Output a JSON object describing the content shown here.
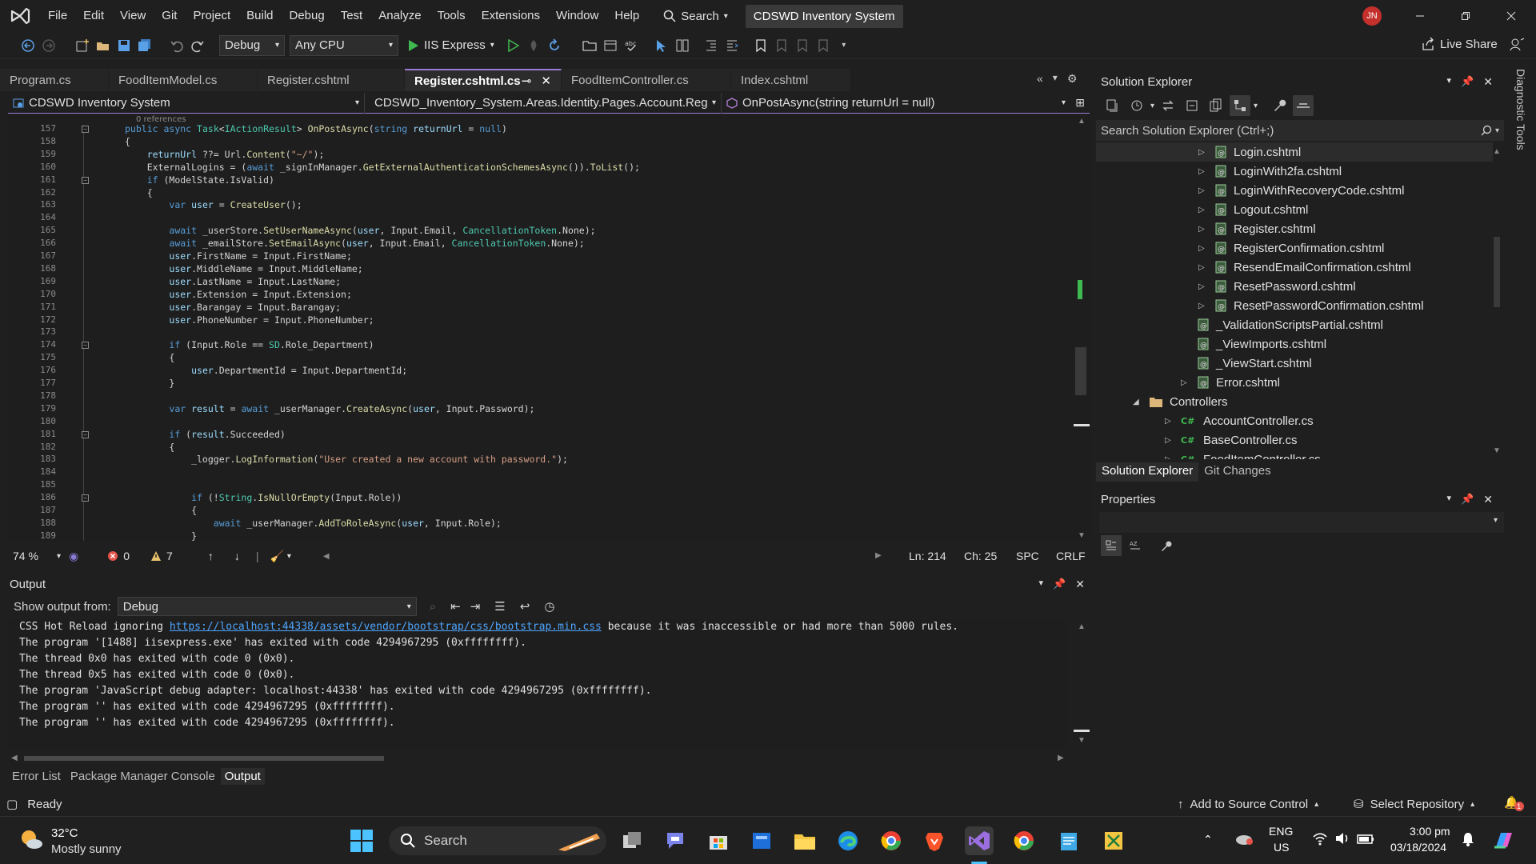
{
  "menu": {
    "items": [
      "File",
      "Edit",
      "View",
      "Git",
      "Project",
      "Build",
      "Debug",
      "Test",
      "Analyze",
      "Tools",
      "Extensions",
      "Window",
      "Help"
    ],
    "search_label": "Search",
    "solution_badge": "CDSWD Inventory System",
    "avatar_initials": "JN"
  },
  "toolbar": {
    "config": "Debug",
    "platform": "Any CPU",
    "run_label": "IIS Express",
    "live_share": "Live Share"
  },
  "tabs": [
    {
      "label": "Program.cs",
      "active": false
    },
    {
      "label": "FoodItemModel.cs",
      "active": false
    },
    {
      "label": "Register.cshtml",
      "active": false
    },
    {
      "label": "Register.cshtml.cs",
      "active": true
    },
    {
      "label": "FoodItemController.cs",
      "active": false
    },
    {
      "label": "Index.cshtml",
      "active": false
    }
  ],
  "navbar": {
    "project": "CDSWD Inventory System",
    "type": "CDSWD_Inventory_System.Areas.Identity.Pages.Account.Regi",
    "member": "OnPostAsync(string returnUrl = null)"
  },
  "editor": {
    "references_hint": "0 references",
    "line_numbers": [
      "157",
      "158",
      "159",
      "160",
      "161",
      "162",
      "163",
      "164",
      "165",
      "166",
      "167",
      "168",
      "169",
      "170",
      "171",
      "172",
      "173",
      "174",
      "175",
      "176",
      "177",
      "178",
      "179",
      "180",
      "181",
      "182",
      "183",
      "184",
      "185",
      "186",
      "187",
      "188",
      "189"
    ],
    "code": [
      "public async Task<IActionResult> OnPostAsync(string returnUrl = null)",
      "{",
      "    returnUrl ??= Url.Content(\"~/\");",
      "    ExternalLogins = (await _signInManager.GetExternalAuthenticationSchemesAsync()).ToList();",
      "    if (ModelState.IsValid)",
      "    {",
      "        var user = CreateUser();",
      "",
      "        await _userStore.SetUserNameAsync(user, Input.Email, CancellationToken.None);",
      "        await _emailStore.SetEmailAsync(user, Input.Email, CancellationToken.None);",
      "        user.FirstName = Input.FirstName;",
      "        user.MiddleName = Input.MiddleName;",
      "        user.LastName = Input.LastName;",
      "        user.Extension = Input.Extension;",
      "        user.Barangay = Input.Barangay;",
      "        user.PhoneNumber = Input.PhoneNumber;",
      "",
      "        if (Input.Role == SD.Role_Department)",
      "        {",
      "            user.DepartmentId = Input.DepartmentId;",
      "        }",
      "",
      "        var result = await _userManager.CreateAsync(user, Input.Password);",
      "",
      "        if (result.Succeeded)",
      "        {",
      "            _logger.LogInformation(\"User created a new account with password.\");",
      "",
      "",
      "            if (!String.IsNullOrEmpty(Input.Role))",
      "            {",
      "                await _userManager.AddToRoleAsync(user, Input.Role);",
      "            }"
    ]
  },
  "editor_status": {
    "zoom": "74 %",
    "errors": "0",
    "warnings": "7",
    "line": "Ln: 214",
    "char": "Ch: 25",
    "spacing": "SPC",
    "eol": "CRLF"
  },
  "output": {
    "title": "Output",
    "show_from_label": "Show output from:",
    "source": "Debug",
    "lines": [
      {
        "pre": "CSS Hot Reload ignoring ",
        "link": "https://localhost:44338/assets/vendor/bootstrap/css/bootstrap.min.css",
        "post": " because it was inaccessible or had more than 5000 rules."
      },
      {
        "pre": "The program '[1488] iisexpress.exe' has exited with code 4294967295 (0xffffffff).",
        "link": "",
        "post": ""
      },
      {
        "pre": "The thread 0x0 has exited with code 0 (0x0).",
        "link": "",
        "post": ""
      },
      {
        "pre": "The thread 0x5 has exited with code 0 (0x0).",
        "link": "",
        "post": ""
      },
      {
        "pre": "The program 'JavaScript debug adapter: localhost:44338' has exited with code 4294967295 (0xffffffff).",
        "link": "",
        "post": ""
      },
      {
        "pre": "The program '' has exited with code 4294967295 (0xffffffff).",
        "link": "",
        "post": ""
      },
      {
        "pre": "The program '' has exited with code 4294967295 (0xffffffff).",
        "link": "",
        "post": ""
      }
    ],
    "bottom_tabs": [
      "Error List",
      "Package Manager Console",
      "Output"
    ]
  },
  "solution_explorer": {
    "title": "Solution Explorer",
    "search_placeholder": "Search Solution Explorer (Ctrl+;)",
    "items": [
      {
        "label": "Login.cshtml",
        "kind": "razor",
        "indent": 2,
        "expander": "collapsed",
        "selected": true
      },
      {
        "label": "LoginWith2fa.cshtml",
        "kind": "razor",
        "indent": 2,
        "expander": "collapsed"
      },
      {
        "label": "LoginWithRecoveryCode.cshtml",
        "kind": "razor",
        "indent": 2,
        "expander": "collapsed"
      },
      {
        "label": "Logout.cshtml",
        "kind": "razor",
        "indent": 2,
        "expander": "collapsed"
      },
      {
        "label": "Register.cshtml",
        "kind": "razor",
        "indent": 2,
        "expander": "collapsed"
      },
      {
        "label": "RegisterConfirmation.cshtml",
        "kind": "razor",
        "indent": 2,
        "expander": "collapsed"
      },
      {
        "label": "ResendEmailConfirmation.cshtml",
        "kind": "razor",
        "indent": 2,
        "expander": "collapsed"
      },
      {
        "label": "ResetPassword.cshtml",
        "kind": "razor",
        "indent": 2,
        "expander": "collapsed"
      },
      {
        "label": "ResetPasswordConfirmation.cshtml",
        "kind": "razor",
        "indent": 2,
        "expander": "collapsed"
      },
      {
        "label": "_ValidationScriptsPartial.cshtml",
        "kind": "razor",
        "indent": 1,
        "expander": "none"
      },
      {
        "label": "_ViewImports.cshtml",
        "kind": "razor",
        "indent": 1,
        "expander": "none"
      },
      {
        "label": "_ViewStart.cshtml",
        "kind": "razor",
        "indent": 1,
        "expander": "none"
      },
      {
        "label": "Error.cshtml",
        "kind": "razor",
        "indent": 1,
        "expander": "collapsed"
      },
      {
        "label": "Controllers",
        "kind": "folder",
        "indent": 0,
        "expander": "expanded"
      },
      {
        "label": "AccountController.cs",
        "kind": "cs",
        "indent": 1,
        "expander": "collapsed"
      },
      {
        "label": "BaseController.cs",
        "kind": "cs",
        "indent": 1,
        "expander": "collapsed"
      },
      {
        "label": "FoodItemController.cs",
        "kind": "cs",
        "indent": 1,
        "expander": "collapsed"
      }
    ],
    "tabs": [
      "Solution Explorer",
      "Git Changes"
    ]
  },
  "properties": {
    "title": "Properties"
  },
  "side_strip": "Diagnostic Tools",
  "statusbar": {
    "ready": "Ready",
    "source_control": "Add to Source Control",
    "repository": "Select Repository",
    "notif_count": "1"
  },
  "taskbar": {
    "temp": "32°C",
    "weather": "Mostly sunny",
    "search": "Search",
    "lang": "ENG",
    "region": "US",
    "time": "3:00 pm",
    "date": "03/18/2024"
  },
  "colors": {
    "accent": "#9b7bd6",
    "keyword": "#569cd6",
    "type": "#4ec9b0",
    "method": "#dcdcaa",
    "string": "#d69d85",
    "link": "#4ea6ff"
  }
}
